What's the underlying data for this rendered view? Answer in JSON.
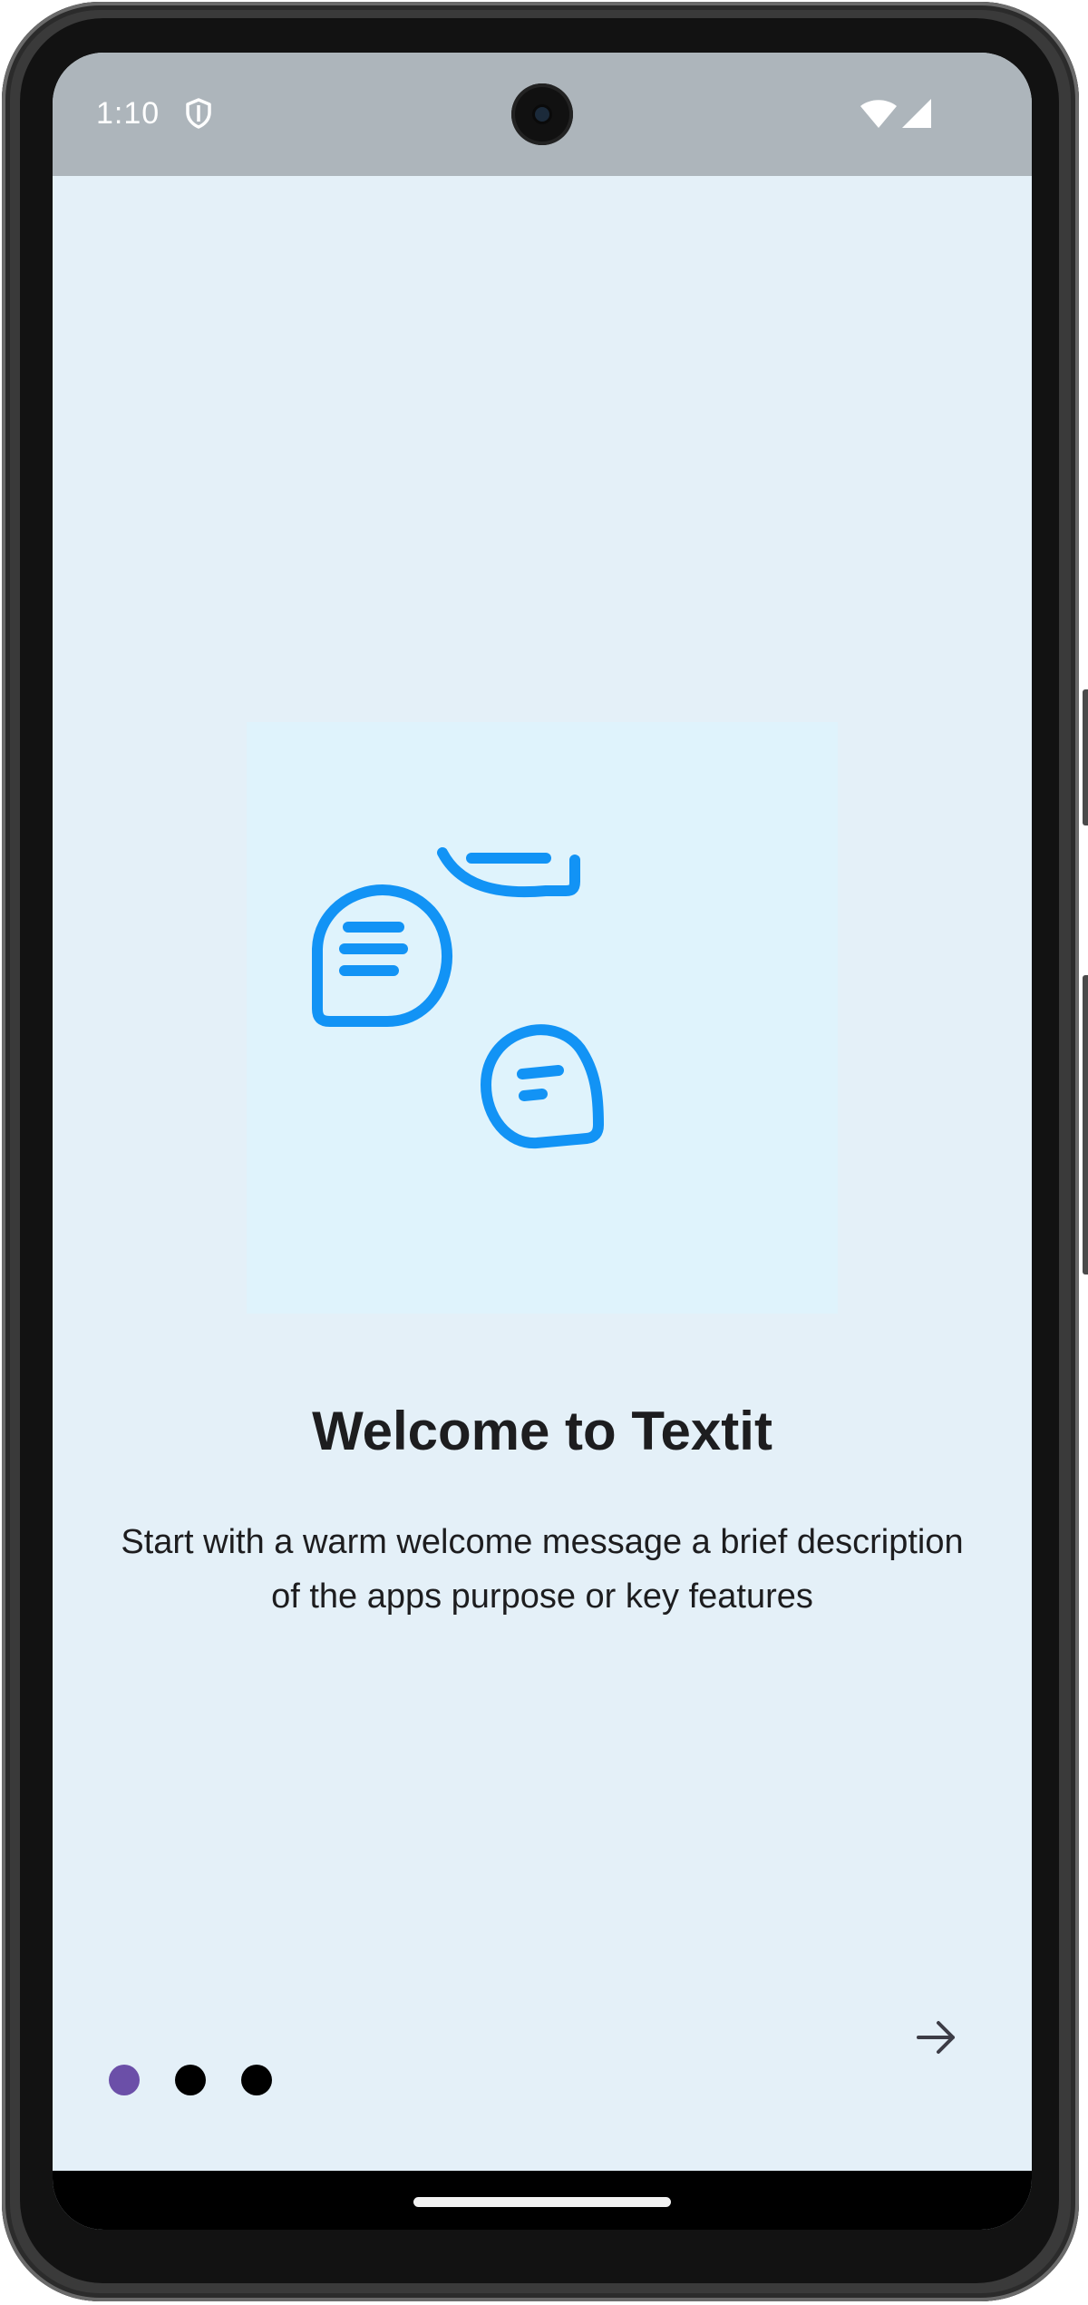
{
  "status_bar": {
    "time": "1:10",
    "shield_icon": "shield-icon",
    "wifi_icon": "wifi-icon",
    "signal_icon": "cellular-signal-icon"
  },
  "onboarding": {
    "illustration_icon": "chat-bubbles-illustration",
    "title": "Welcome to Textit",
    "description": "Start with a warm welcome message a brief description of the apps purpose or key features",
    "next_icon": "arrow-right-icon",
    "page_indicator": {
      "count": 3,
      "active_index": 0,
      "active_color": "#6b4fa8",
      "inactive_color": "#000000"
    }
  },
  "colors": {
    "background": "#e4f0f8",
    "status_bar": "#adb5bb",
    "illustration_bg": "#dff3fc",
    "accent_blue": "#1293f5",
    "text": "#1d1d1f"
  }
}
